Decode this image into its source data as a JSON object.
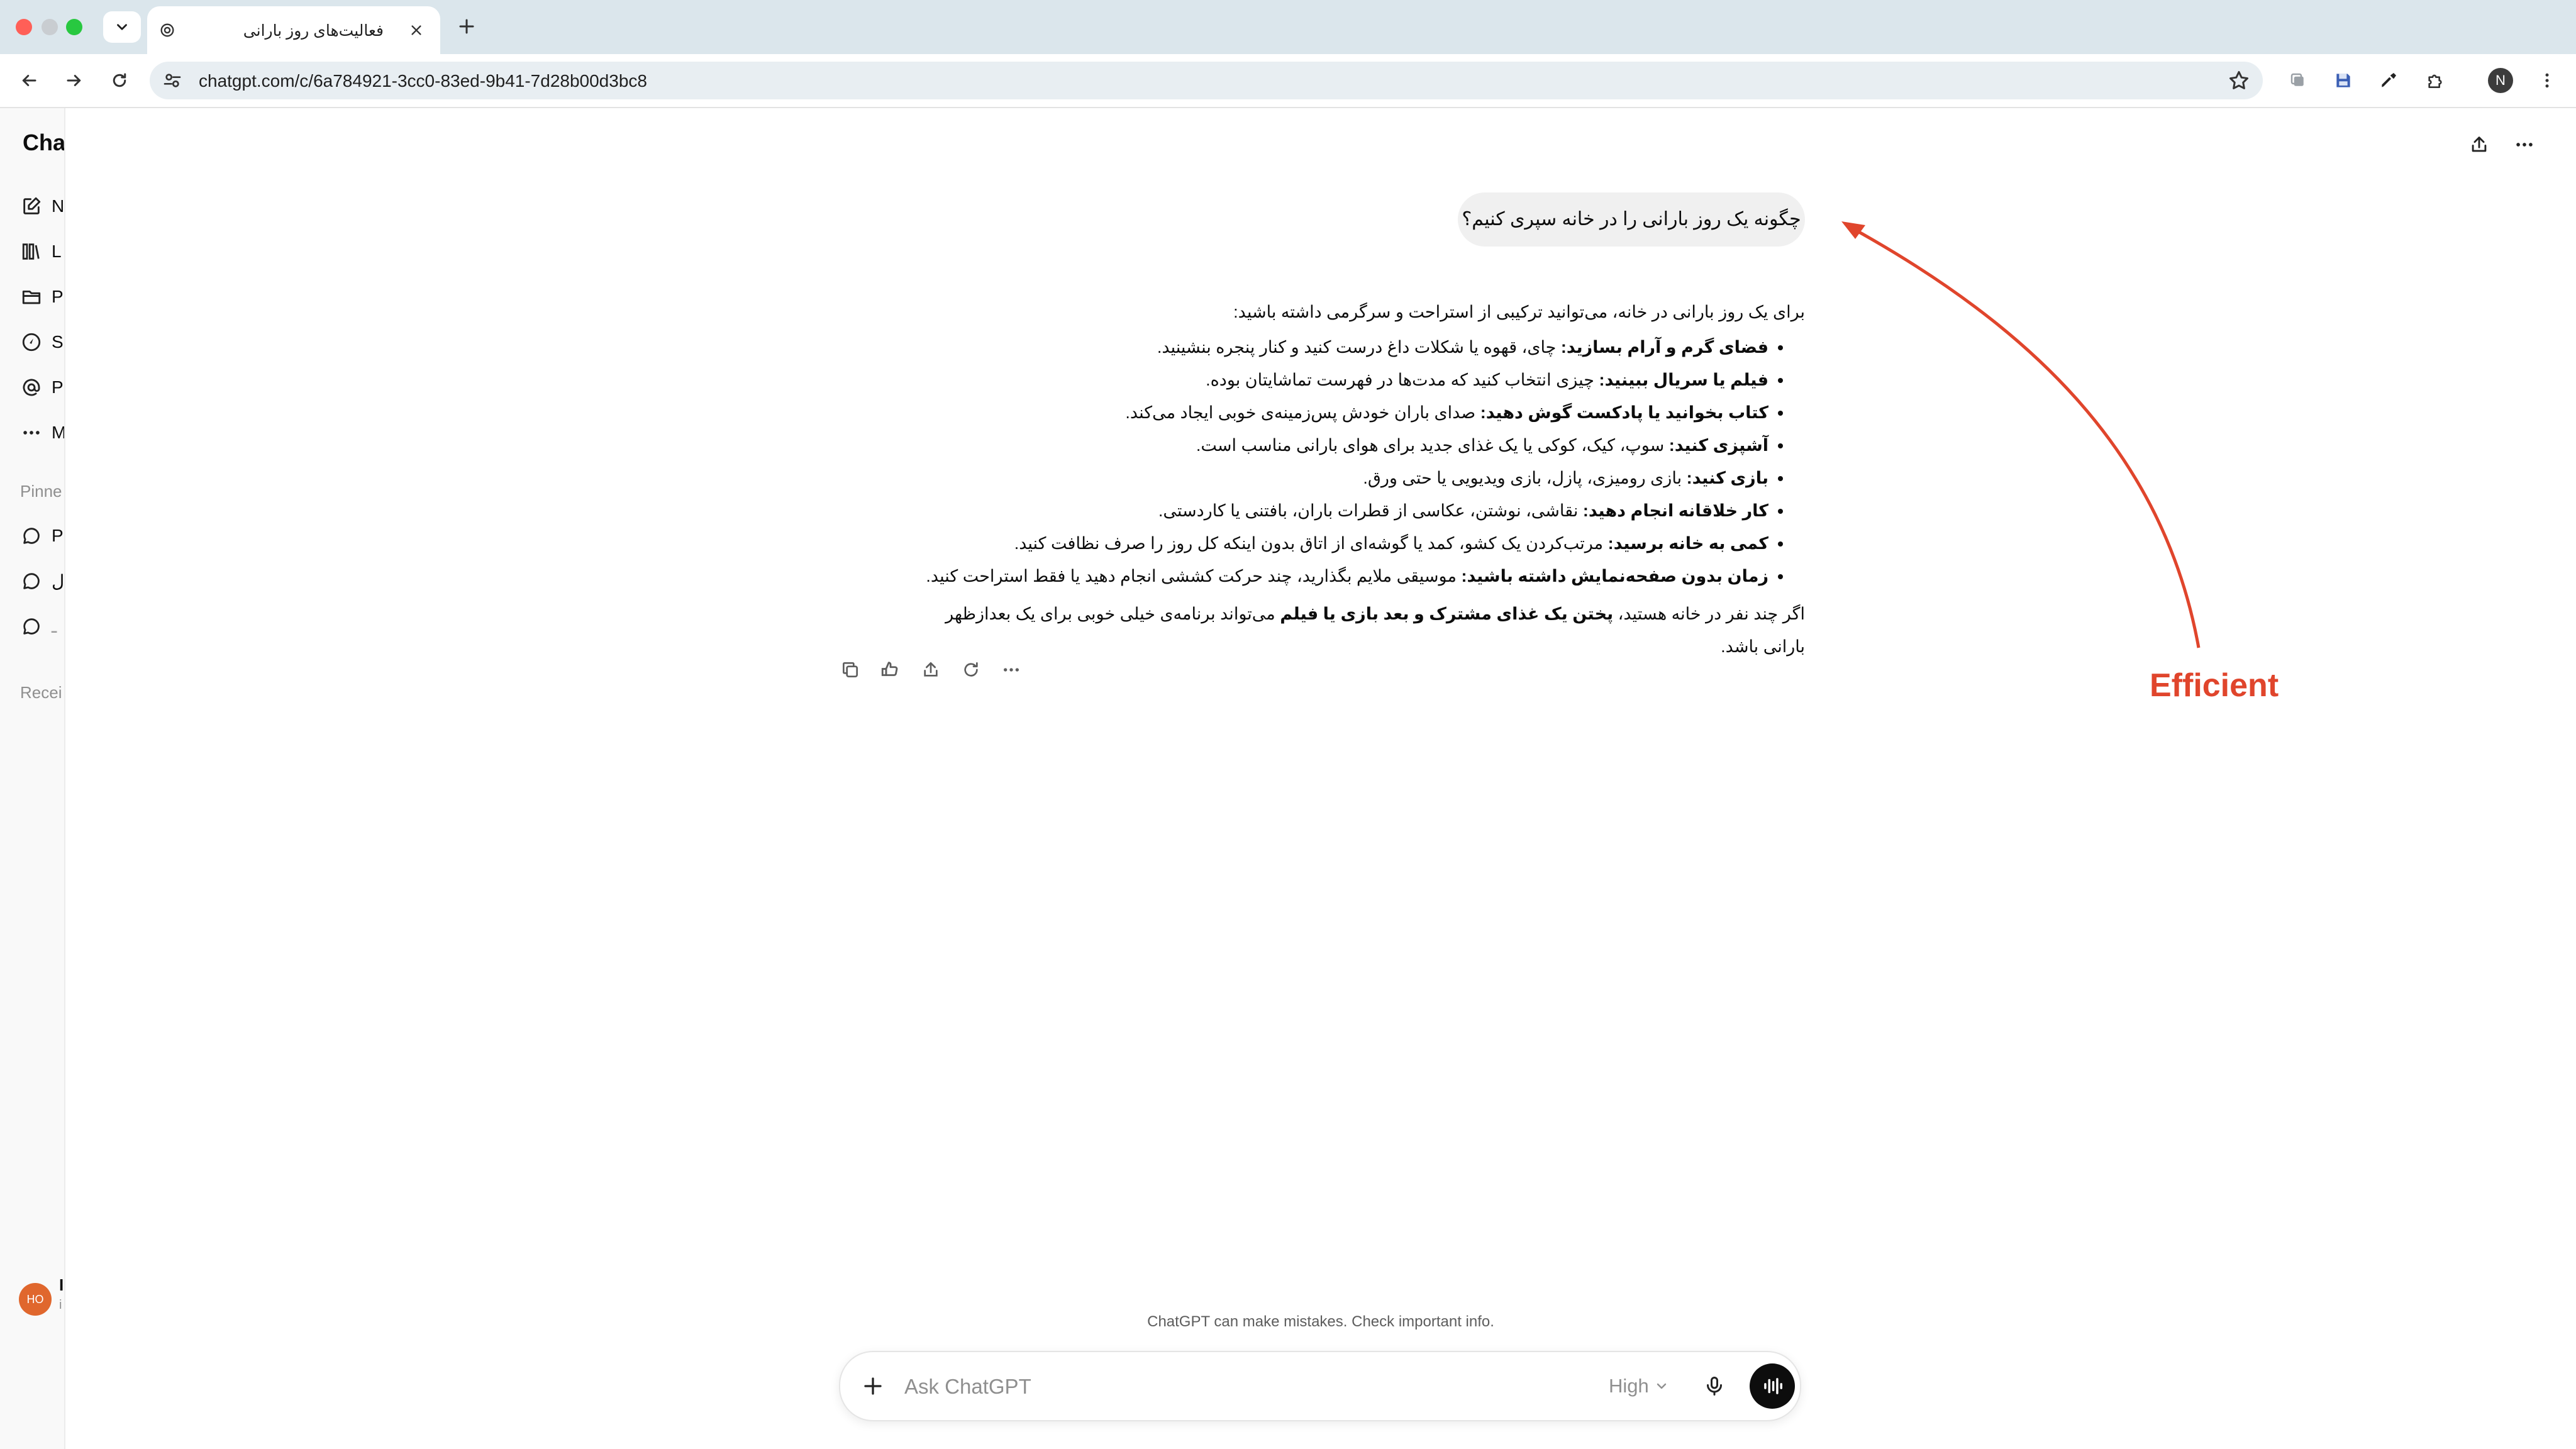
{
  "browser": {
    "tab_title": "فعالیت‌های روز بارانی",
    "url": "chatgpt.com/c/6a784921-3cc0-83ed-9b41-7d28b00d3bc8",
    "profile_initial": "N"
  },
  "sidebar": {
    "brand": "Cha",
    "items": [
      {
        "label": "N",
        "icon": "new-chat-icon"
      },
      {
        "label": "L",
        "icon": "library-icon"
      },
      {
        "label": "P",
        "icon": "folder-icon"
      },
      {
        "label": "S",
        "icon": "explore-icon"
      },
      {
        "label": "P",
        "icon": "at-icon"
      },
      {
        "label": "M",
        "icon": "more-icon"
      }
    ],
    "pinned_label": "Pinne",
    "pinned_items": [
      {
        "label": "P"
      },
      {
        "label": "ل"
      },
      {
        "label": "ـ"
      }
    ],
    "recent_label": "Recei",
    "user": {
      "initials": "HO",
      "name": "I",
      "sub": "i"
    }
  },
  "conversation": {
    "user_message": "چگونه یک روز بارانی را در خانه سپری کنیم؟",
    "answer_intro": "برای یک روز بارانی در خانه، می‌توانید ترکیبی از استراحت و سرگرمی داشته باشید:",
    "answer_items": [
      {
        "bold": "فضای گرم و آرام بسازید:",
        "text": " چای، قهوه یا شکلات داغ درست کنید و کنار پنجره بنشینید."
      },
      {
        "bold": "فیلم یا سریال ببینید:",
        "text": " چیزی انتخاب کنید که مدت‌ها در فهرست تماشایتان بوده."
      },
      {
        "bold": "کتاب بخوانید یا پادکست گوش دهید:",
        "text": " صدای باران خودش پس‌زمینه‌ی خوبی ایجاد می‌کند."
      },
      {
        "bold": "آشپزی کنید:",
        "text": " سوپ، کیک، کوکی یا یک غذای جدید برای هوای بارانی مناسب است."
      },
      {
        "bold": "بازی کنید:",
        "text": " بازی رومیزی، پازل، بازی ویدیویی یا حتی ورق."
      },
      {
        "bold": "کار خلاقانه انجام دهید:",
        "text": " نقاشی، نوشتن، عکاسی از قطرات باران، بافتنی یا کاردستی."
      },
      {
        "bold": "کمی به خانه برسید:",
        "text": " مرتب‌کردن یک کشو، کمد یا گوشه‌ای از اتاق بدون اینکه کل روز را صرف نظافت کنید."
      },
      {
        "bold": "زمان بدون صفحه‌نمایش داشته باشید:",
        "text": " موسیقی ملایم بگذارید، چند حرکت کششی انجام دهید یا فقط استراحت کنید."
      }
    ],
    "answer_outro_pre": "اگر چند نفر در خانه هستید، ",
    "answer_outro_bold": "پختن یک غذای مشترک و بعد بازی یا فیلم",
    "answer_outro_post": " می‌تواند برنامه‌ی خیلی خوبی برای یک بعدازظهر بارانی باشد."
  },
  "annotation": {
    "label": "Efficient",
    "color": "#e0452c"
  },
  "composer": {
    "disclaimer": "ChatGPT can make mistakes. Check important info.",
    "placeholder": "Ask ChatGPT",
    "model_label": "High"
  }
}
